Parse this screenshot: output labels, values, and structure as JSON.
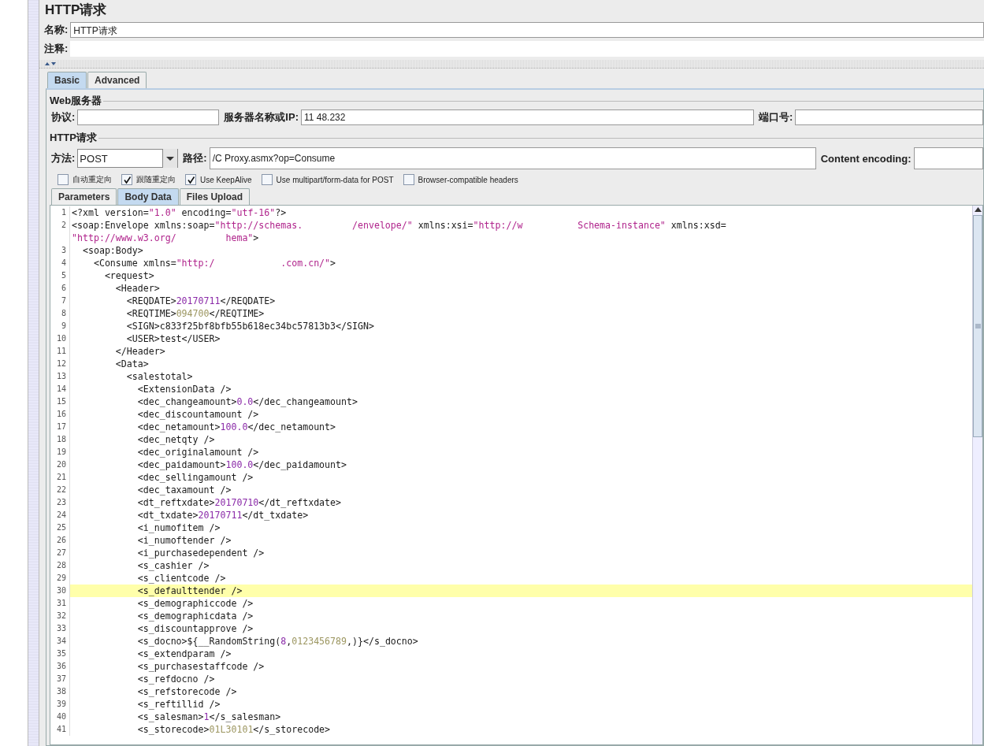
{
  "title": "HTTP请求",
  "name_field": {
    "label": "名称:",
    "value": "HTTP请求"
  },
  "comment_field": {
    "label": "注释:"
  },
  "tabs": [
    {
      "label": "Basic",
      "selected": true
    },
    {
      "label": "Advanced",
      "selected": false
    }
  ],
  "web_server": {
    "legend": "Web服务器",
    "protocol_label": "协议:",
    "server_label": "服务器名称或IP:",
    "server_value": "11  48.232",
    "port_label": "端口号:"
  },
  "http_request": {
    "legend": "HTTP请求",
    "method_label": "方法:",
    "method_value": "POST",
    "path_label": "路径:",
    "path_value": "/C   Proxy.asmx?op=Consume",
    "encoding_label": "Content encoding:"
  },
  "options": [
    {
      "label": "自动重定向",
      "checked": false
    },
    {
      "label": "跟随重定向",
      "checked": true
    },
    {
      "label": "Use KeepAlive",
      "checked": true
    },
    {
      "label": "Use multipart/form-data for POST",
      "checked": false
    },
    {
      "label": "Browser-compatible headers",
      "checked": false
    }
  ],
  "body_tabs": [
    {
      "label": "Parameters",
      "selected": false
    },
    {
      "label": "Body Data",
      "selected": true
    },
    {
      "label": "Files Upload",
      "selected": false
    }
  ],
  "code_lines": [
    {
      "n": "1",
      "highlighted": false,
      "tokens": [
        {
          "kind": "markup",
          "text": "<?xml version="
        },
        {
          "kind": "string",
          "text": "\"1.0\""
        },
        {
          "kind": "markup",
          "text": " encoding="
        },
        {
          "kind": "string",
          "text": "\"utf-16\""
        },
        {
          "kind": "markup",
          "text": "?>"
        }
      ]
    },
    {
      "n": "2",
      "highlighted": false,
      "tokens": [
        {
          "kind": "markup",
          "text": "<soap:Envelope xmlns:soap="
        },
        {
          "kind": "string",
          "text": "\"http://schemas.         /envelope/\""
        },
        {
          "kind": "markup",
          "text": " xmlns:xsi="
        },
        {
          "kind": "string",
          "text": "\"http://w          Schema-instance\""
        },
        {
          "kind": "markup",
          "text": " xmlns:xsd="
        }
      ]
    },
    {
      "highlighted": false,
      "tokens": [
        {
          "kind": "string",
          "text": "\"http://www.w3.org/         hema\""
        },
        {
          "kind": "markup",
          "text": ">"
        }
      ]
    },
    {
      "n": "3",
      "highlighted": false,
      "tokens": [
        {
          "kind": "markup",
          "text": "  <soap:Body>"
        }
      ]
    },
    {
      "n": "4",
      "highlighted": false,
      "tokens": [
        {
          "kind": "markup",
          "text": "    <Consume xmlns="
        },
        {
          "kind": "string",
          "text": "\"http:/            .com.cn/\""
        },
        {
          "kind": "markup",
          "text": ">"
        }
      ]
    },
    {
      "n": "5",
      "highlighted": false,
      "tokens": [
        {
          "kind": "markup",
          "text": "      <request>"
        }
      ]
    },
    {
      "n": "6",
      "highlighted": false,
      "tokens": [
        {
          "kind": "markup",
          "text": "        <Header>"
        }
      ]
    },
    {
      "n": "7",
      "highlighted": false,
      "tokens": [
        {
          "kind": "markup",
          "text": "          <REQDATE>"
        },
        {
          "kind": "number",
          "text": "20170711"
        },
        {
          "kind": "markup",
          "text": "</REQDATE>"
        }
      ]
    },
    {
      "n": "8",
      "highlighted": false,
      "tokens": [
        {
          "kind": "markup",
          "text": "          <REQTIME>"
        },
        {
          "kind": "literal",
          "text": "094700"
        },
        {
          "kind": "markup",
          "text": "</REQTIME>"
        }
      ]
    },
    {
      "n": "9",
      "highlighted": false,
      "tokens": [
        {
          "kind": "markup",
          "text": "          <SIGN>c833f25bf8bfb55b618ec34bc57813b3</SIGN>"
        }
      ]
    },
    {
      "n": "10",
      "highlighted": false,
      "tokens": [
        {
          "kind": "markup",
          "text": "          <USER>test</USER>"
        }
      ]
    },
    {
      "n": "11",
      "highlighted": false,
      "tokens": [
        {
          "kind": "markup",
          "text": "        </Header>"
        }
      ]
    },
    {
      "n": "12",
      "highlighted": false,
      "tokens": [
        {
          "kind": "markup",
          "text": "        <Data>"
        }
      ]
    },
    {
      "n": "13",
      "highlighted": false,
      "tokens": [
        {
          "kind": "markup",
          "text": "          <salestotal>"
        }
      ]
    },
    {
      "n": "14",
      "highlighted": false,
      "tokens": [
        {
          "kind": "markup",
          "text": "            <ExtensionData />"
        }
      ]
    },
    {
      "n": "15",
      "highlighted": false,
      "tokens": [
        {
          "kind": "markup",
          "text": "            <dec_changeamount>"
        },
        {
          "kind": "number",
          "text": "0.0"
        },
        {
          "kind": "markup",
          "text": "</dec_changeamount>"
        }
      ]
    },
    {
      "n": "16",
      "highlighted": false,
      "tokens": [
        {
          "kind": "markup",
          "text": "            <dec_discountamount />"
        }
      ]
    },
    {
      "n": "17",
      "highlighted": false,
      "tokens": [
        {
          "kind": "markup",
          "text": "            <dec_netamount>"
        },
        {
          "kind": "number",
          "text": "100.0"
        },
        {
          "kind": "markup",
          "text": "</dec_netamount>"
        }
      ]
    },
    {
      "n": "18",
      "highlighted": false,
      "tokens": [
        {
          "kind": "markup",
          "text": "            <dec_netqty />"
        }
      ]
    },
    {
      "n": "19",
      "highlighted": false,
      "tokens": [
        {
          "kind": "markup",
          "text": "            <dec_originalamount />"
        }
      ]
    },
    {
      "n": "20",
      "highlighted": false,
      "tokens": [
        {
          "kind": "markup",
          "text": "            <dec_paidamount>"
        },
        {
          "kind": "number",
          "text": "100.0"
        },
        {
          "kind": "markup",
          "text": "</dec_paidamount>"
        }
      ]
    },
    {
      "n": "21",
      "highlighted": false,
      "tokens": [
        {
          "kind": "markup",
          "text": "            <dec_sellingamount />"
        }
      ]
    },
    {
      "n": "22",
      "highlighted": false,
      "tokens": [
        {
          "kind": "markup",
          "text": "            <dec_taxamount />"
        }
      ]
    },
    {
      "n": "23",
      "highlighted": false,
      "tokens": [
        {
          "kind": "markup",
          "text": "            <dt_reftxdate>"
        },
        {
          "kind": "number",
          "text": "20170710"
        },
        {
          "kind": "markup",
          "text": "</dt_reftxdate>"
        }
      ]
    },
    {
      "n": "24",
      "highlighted": false,
      "tokens": [
        {
          "kind": "markup",
          "text": "            <dt_txdate>"
        },
        {
          "kind": "number",
          "text": "20170711"
        },
        {
          "kind": "markup",
          "text": "</dt_txdate>"
        }
      ]
    },
    {
      "n": "25",
      "highlighted": false,
      "tokens": [
        {
          "kind": "markup",
          "text": "            <i_numofitem />"
        }
      ]
    },
    {
      "n": "26",
      "highlighted": false,
      "tokens": [
        {
          "kind": "markup",
          "text": "            <i_numoftender />"
        }
      ]
    },
    {
      "n": "27",
      "highlighted": false,
      "tokens": [
        {
          "kind": "markup",
          "text": "            <i_purchasedependent />"
        }
      ]
    },
    {
      "n": "28",
      "highlighted": false,
      "tokens": [
        {
          "kind": "markup",
          "text": "            <s_cashier />"
        }
      ]
    },
    {
      "n": "29",
      "highlighted": false,
      "tokens": [
        {
          "kind": "markup",
          "text": "            <s_clientcode />"
        }
      ]
    },
    {
      "n": "30",
      "highlighted": true,
      "tokens": [
        {
          "kind": "markup",
          "text": "            <s_defaulttender />"
        }
      ]
    },
    {
      "n": "31",
      "highlighted": false,
      "tokens": [
        {
          "kind": "markup",
          "text": "            <s_demographiccode />"
        }
      ]
    },
    {
      "n": "32",
      "highlighted": false,
      "tokens": [
        {
          "kind": "markup",
          "text": "            <s_demographicdata />"
        }
      ]
    },
    {
      "n": "33",
      "highlighted": false,
      "tokens": [
        {
          "kind": "markup",
          "text": "            <s_discountapprove />"
        }
      ]
    },
    {
      "n": "34",
      "highlighted": false,
      "tokens": [
        {
          "kind": "markup",
          "text": "            <s_docno>${__RandomString("
        },
        {
          "kind": "number",
          "text": "8"
        },
        {
          "kind": "markup",
          "text": ","
        },
        {
          "kind": "literal",
          "text": "0123456789"
        },
        {
          "kind": "markup",
          "text": ",)}</s_docno>"
        }
      ]
    },
    {
      "n": "35",
      "highlighted": false,
      "tokens": [
        {
          "kind": "markup",
          "text": "            <s_extendparam />"
        }
      ]
    },
    {
      "n": "36",
      "highlighted": false,
      "tokens": [
        {
          "kind": "markup",
          "text": "            <s_purchasestaffcode />"
        }
      ]
    },
    {
      "n": "37",
      "highlighted": false,
      "tokens": [
        {
          "kind": "markup",
          "text": "            <s_refdocno />"
        }
      ]
    },
    {
      "n": "38",
      "highlighted": false,
      "tokens": [
        {
          "kind": "markup",
          "text": "            <s_refstorecode />"
        }
      ]
    },
    {
      "n": "39",
      "highlighted": false,
      "tokens": [
        {
          "kind": "markup",
          "text": "            <s_reftillid />"
        }
      ]
    },
    {
      "n": "40",
      "highlighted": false,
      "tokens": [
        {
          "kind": "markup",
          "text": "            <s_salesman>"
        },
        {
          "kind": "number",
          "text": "1"
        },
        {
          "kind": "markup",
          "text": "</s_salesman>"
        }
      ]
    },
    {
      "n": "41",
      "highlighted": false,
      "tokens": [
        {
          "kind": "markup",
          "text": "            <s_storecode>"
        },
        {
          "kind": "literal",
          "text": "01L30101"
        },
        {
          "kind": "markup",
          "text": "</s_storecode>"
        }
      ]
    }
  ]
}
